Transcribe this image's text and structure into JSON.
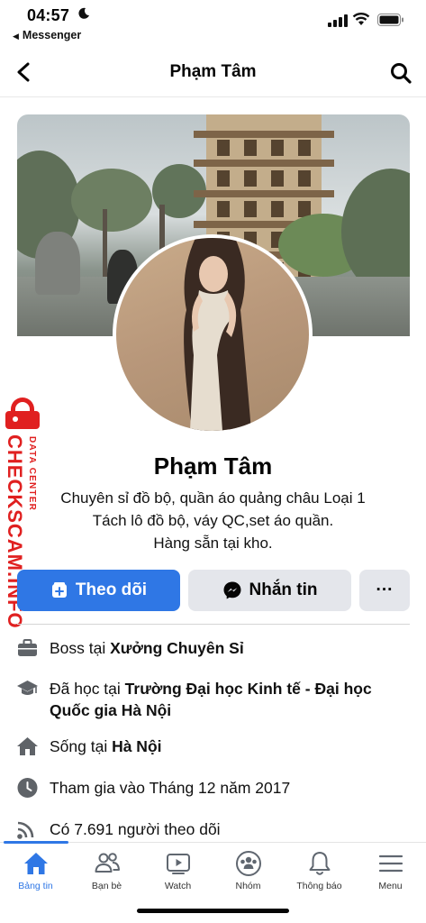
{
  "status_bar": {
    "time": "04:57",
    "back_app": "Messenger"
  },
  "header": {
    "title": "Phạm Tâm"
  },
  "profile": {
    "name": "Phạm Tâm",
    "bio": [
      "Chuyên sỉ đồ bộ, quần áo quảng châu Loại 1",
      "Tách lô đồ bộ, váy QC,set áo quần.",
      "Hàng sẵn tại kho."
    ]
  },
  "actions": {
    "follow": "Theo dõi",
    "message": "Nhắn tin",
    "more": "···"
  },
  "watermark": {
    "brand": "CHECKSCAM.INFO",
    "sub": "DATA CENTER"
  },
  "details": {
    "work": {
      "prefix": "Boss tại ",
      "value": "Xưởng Chuyên Sỉ"
    },
    "education": {
      "prefix": "Đã học tại ",
      "value": "Trường Đại học Kinh tế - Đại học Quốc gia Hà Nội"
    },
    "lives": {
      "prefix": "Sống tại ",
      "value": "Hà Nội"
    },
    "joined": {
      "text": "Tham gia vào Tháng 12 năm 2017"
    },
    "followers": {
      "text": "Có 7.691 người theo dõi"
    }
  },
  "tabs": [
    {
      "label": "Bảng tin",
      "icon": "home-icon",
      "active": true
    },
    {
      "label": "Bạn bè",
      "icon": "friends-icon",
      "active": false
    },
    {
      "label": "Watch",
      "icon": "watch-icon",
      "active": false
    },
    {
      "label": "Nhóm",
      "icon": "groups-icon",
      "active": false
    },
    {
      "label": "Thông báo",
      "icon": "bell-icon",
      "active": false
    },
    {
      "label": "Menu",
      "icon": "menu-icon",
      "active": false
    }
  ],
  "colors": {
    "accent": "#2F77E5",
    "button_gray": "#E4E6EB",
    "watermark_red": "#E02020"
  }
}
